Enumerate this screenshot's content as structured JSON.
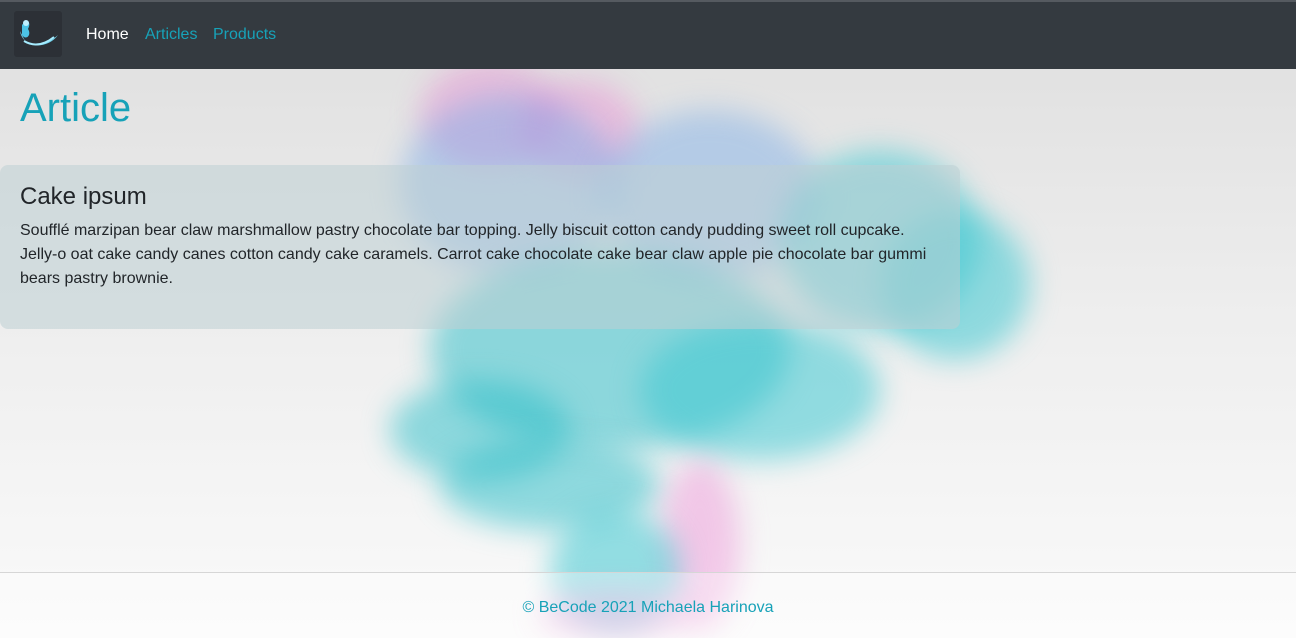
{
  "nav": {
    "logo_icon": "ink-wave-logo-icon",
    "items": [
      {
        "label": "Home",
        "active": true
      },
      {
        "label": "Articles",
        "active": false
      },
      {
        "label": "Products",
        "active": false
      }
    ]
  },
  "main": {
    "title": "Article",
    "card": {
      "heading": "Cake ipsum",
      "body": "Soufflé marzipan bear claw marshmallow pastry chocolate bar topping. Jelly biscuit cotton candy pudding sweet roll cupcake. Jelly-o oat cake candy canes cotton candy cake caramels. Carrot cake chocolate cake bear claw apple pie chocolate bar gummi bears pastry brownie."
    }
  },
  "footer": {
    "text": "© BeCode 2021 Michaela Harinova"
  },
  "colors": {
    "navbar_bg": "#343a40",
    "accent": "#17a2b8",
    "active_link": "#ffffff",
    "text": "#212529"
  }
}
